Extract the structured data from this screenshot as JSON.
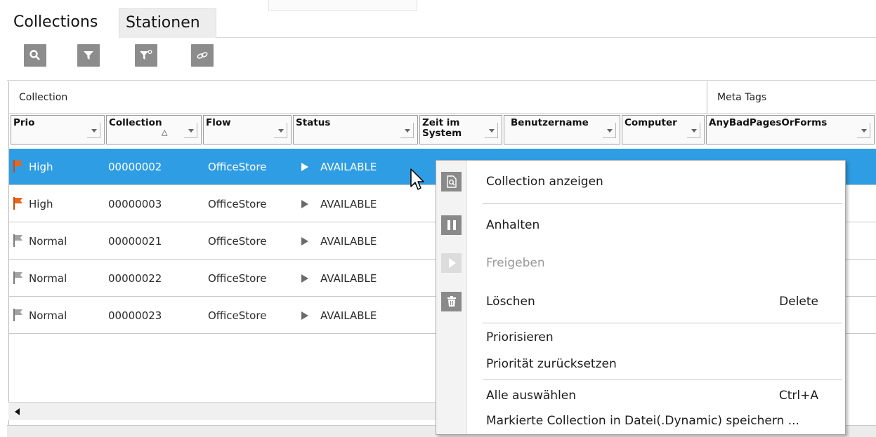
{
  "tabs": [
    {
      "label": "Collections",
      "active": true
    },
    {
      "label": "Stationen",
      "active": false
    }
  ],
  "toolbar": {
    "buttons": [
      {
        "icon": "search-icon"
      },
      {
        "icon": "filter-icon"
      },
      {
        "icon": "filter-settings-icon"
      },
      {
        "icon": "link-icon"
      }
    ]
  },
  "grid": {
    "groups": {
      "collection": "Collection",
      "meta": "Meta Tags"
    },
    "columns": [
      {
        "key": "prio",
        "label": "Prio"
      },
      {
        "key": "collection",
        "label": "Collection",
        "sorted": "ascending"
      },
      {
        "key": "flow",
        "label": "Flow"
      },
      {
        "key": "status",
        "label": "Status"
      },
      {
        "key": "zeit",
        "label": "Zeit im System"
      },
      {
        "key": "benutzer",
        "label": "Benutzername"
      },
      {
        "key": "computer",
        "label": "Computer"
      },
      {
        "key": "anybad",
        "label": "AnyBadPagesOrForms"
      }
    ],
    "rows": [
      {
        "prio": "High",
        "flag": "orange",
        "collection": "00000002",
        "flow": "OfficeStore",
        "status": "AVAILABLE",
        "selected": true
      },
      {
        "prio": "High",
        "flag": "orange",
        "collection": "00000003",
        "flow": "OfficeStore",
        "status": "AVAILABLE",
        "selected": false
      },
      {
        "prio": "Normal",
        "flag": "gray",
        "collection": "00000021",
        "flow": "OfficeStore",
        "status": "AVAILABLE",
        "selected": false
      },
      {
        "prio": "Normal",
        "flag": "gray",
        "collection": "00000022",
        "flow": "OfficeStore",
        "status": "AVAILABLE",
        "selected": false
      },
      {
        "prio": "Normal",
        "flag": "gray",
        "collection": "00000023",
        "flow": "OfficeStore",
        "status": "AVAILABLE",
        "selected": false
      }
    ]
  },
  "context_menu": {
    "items": [
      {
        "label": "Collection anzeigen",
        "icon": "view-collection-icon",
        "enabled": true
      },
      {
        "label": "Anhalten",
        "icon": "pause-icon",
        "enabled": true
      },
      {
        "label": "Freigeben",
        "icon": "play-icon",
        "enabled": false
      },
      {
        "label": "Löschen",
        "icon": "trash-icon",
        "shortcut": "Delete",
        "enabled": true
      },
      {
        "label": "Priorisieren",
        "enabled": true
      },
      {
        "label": "Priorität zurücksetzen",
        "enabled": true
      },
      {
        "label": "Alle auswählen",
        "shortcut": "Ctrl+A",
        "enabled": true
      },
      {
        "label": "Markierte Collection in Datei(.Dynamic) speichern ...",
        "enabled": true
      }
    ]
  },
  "colors": {
    "selection": "#2f9de3",
    "flag_high": "#e8661e",
    "flag_normal": "#8f8f8f",
    "icon_gray": "#8c8c8c"
  }
}
